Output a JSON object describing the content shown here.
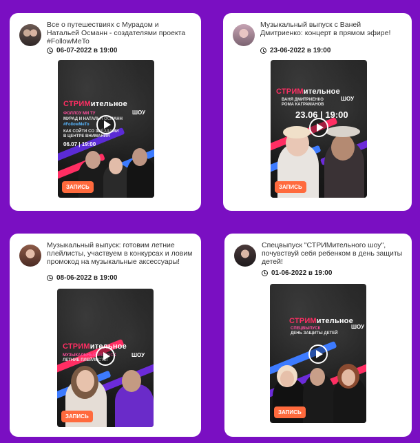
{
  "cards": [
    {
      "title": "Все о путешествиях с Мурадом и Натальей Османн - создателями проекта #FollowMeTo",
      "date": "06-07-2022 в 19:00",
      "poster": {
        "brand_a": "СТРИМ",
        "brand_b": "ительное",
        "brand_show": "ШОУ",
        "lines": [
          "ФОЛЛОУ МИ ТУ",
          "МУРАД И НАТАЛЬЯ ОСМАНН",
          "#FollowMeTo",
          "КАК СОЙТИ СО ЗВЁЗДАМИ",
          "В ЦЕНТРЕ ВНИМАНИЯ"
        ],
        "poster_date": "06.07 | 19:00",
        "record_label": "ЗАПИСЬ"
      }
    },
    {
      "title": "Музыкальный выпуск с Ваней Дмитриенко: концерт в прямом эфире!",
      "date": "23-06-2022 в 19:00",
      "poster": {
        "brand_a": "СТРИМ",
        "brand_b": "ительное",
        "brand_show": "ШОУ",
        "lines": [
          "ВАНЯ ДМИТРИЕНКО",
          "РОМА КАГРАМАНОВ"
        ],
        "poster_date": "23.06 | 19:00",
        "record_label": "ЗАПИСЬ"
      }
    },
    {
      "title": "Музыкальный выпуск: готовим летние плейлисты, участвуем в конкурсах и ловим промокод на музыкальные аксессуары!",
      "date": "08-06-2022 в 19:00",
      "poster": {
        "brand_a": "СТРИМ",
        "brand_b": "ительное",
        "brand_show": "ШОУ",
        "lines": [
          "МУЗЫКАЛЬНЫЙ ВЫПУСК",
          "ЛЕТНИЕ ПЛЕЙЛИСТЫ"
        ],
        "poster_date": "",
        "record_label": "ЗАПИСЬ"
      }
    },
    {
      "title": "Спецвыпуск \"СТРИМительного шоу\", почувствуй себя ребенком в день защиты детей!",
      "date": "01-06-2022 в 19:00",
      "poster": {
        "brand_a": "СТРИМ",
        "brand_b": "ительное",
        "brand_show": "ШОУ",
        "lines": [
          "СПЕЦВЫПУСК",
          "ДЕНЬ ЗАЩИТЫ ДЕТЕЙ"
        ],
        "poster_date": "",
        "record_label": "ЗАПИСЬ"
      }
    }
  ],
  "colors": {
    "background": "#7a0fc2",
    "brand_pink": "#ff2e63",
    "record_orange": "#ff6a3d"
  },
  "icons": [
    "clock-icon",
    "play-icon"
  ]
}
